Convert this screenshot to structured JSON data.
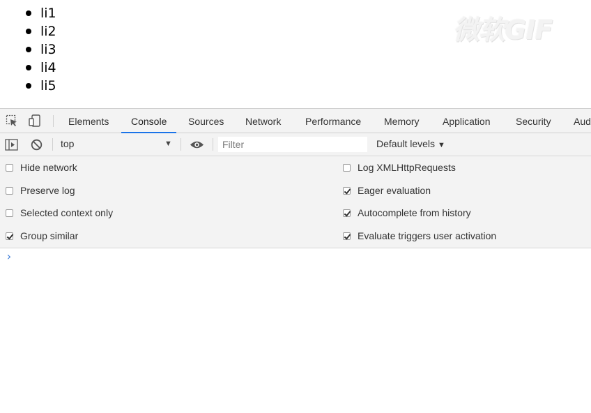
{
  "page": {
    "list_items": [
      "li1",
      "li2",
      "li3",
      "li4",
      "li5"
    ],
    "watermark": "微软GIF"
  },
  "devtools": {
    "tools": [
      {
        "icon": "inspect-element-icon"
      },
      {
        "icon": "device-toolbar-icon"
      }
    ],
    "tabs": [
      "Elements",
      "Console",
      "Sources",
      "Network",
      "Performance",
      "Memory",
      "Application",
      "Security",
      "Aud"
    ],
    "active_tab": "Console",
    "toolbar": {
      "context": "top",
      "filter_value": "",
      "filter_placeholder": "Filter",
      "levels": "Default levels"
    },
    "settings_left": [
      {
        "label": "Hide network",
        "checked": false
      },
      {
        "label": "Preserve log",
        "checked": false
      },
      {
        "label": "Selected context only",
        "checked": false
      },
      {
        "label": "Group similar",
        "checked": true
      }
    ],
    "settings_right": [
      {
        "label": "Log XMLHttpRequests",
        "checked": false
      },
      {
        "label": "Eager evaluation",
        "checked": true
      },
      {
        "label": "Autocomplete from history",
        "checked": true
      },
      {
        "label": "Evaluate triggers user activation",
        "checked": true
      }
    ],
    "prompt": "›",
    "colors": {
      "accent": "#1a73e8",
      "prompt": "#3b7bd7",
      "panel": "#f3f3f3"
    }
  }
}
